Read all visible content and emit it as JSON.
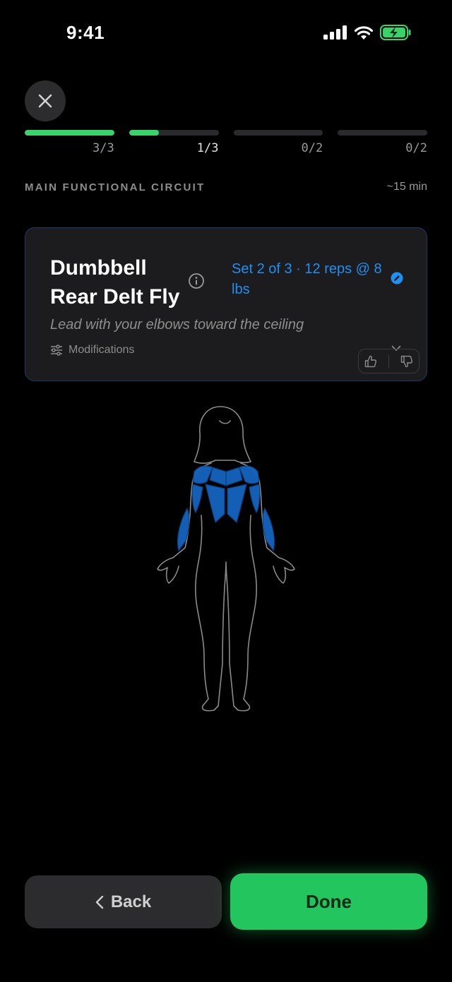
{
  "status_bar": {
    "time": "9:41"
  },
  "progress": {
    "segments": [
      {
        "label": "3/3",
        "fill_fraction": 1.0,
        "active": false
      },
      {
        "label": "1/3",
        "fill_fraction": 0.33,
        "active": true
      },
      {
        "label": "0/2",
        "fill_fraction": 0.0,
        "active": false
      },
      {
        "label": "0/2",
        "fill_fraction": 0.0,
        "active": false
      }
    ]
  },
  "section": {
    "title": "MAIN FUNCTIONAL CIRCUIT",
    "duration": "~15 min"
  },
  "exercise": {
    "name": "Dumbbell Rear Delt Fly",
    "set_info": "Set 2 of 3 · 12 reps @ 8 lbs",
    "cue": "Lead with your elbows toward the ceiling",
    "modifications_label": "Modifications"
  },
  "buttons": {
    "back": "Back",
    "done": "Done"
  },
  "colors": {
    "accent_green": "#22c55e",
    "progress_green": "#37d46a",
    "accent_blue": "#1f8ff0",
    "muscle_blue": "#1565c0"
  },
  "icons": [
    "close-icon",
    "info-icon",
    "edit-icon",
    "sliders-icon",
    "chevron-down-icon",
    "thumbs-up-icon",
    "thumbs-down-icon",
    "chevron-left-icon",
    "signal-icon",
    "wifi-icon",
    "battery-icon"
  ]
}
